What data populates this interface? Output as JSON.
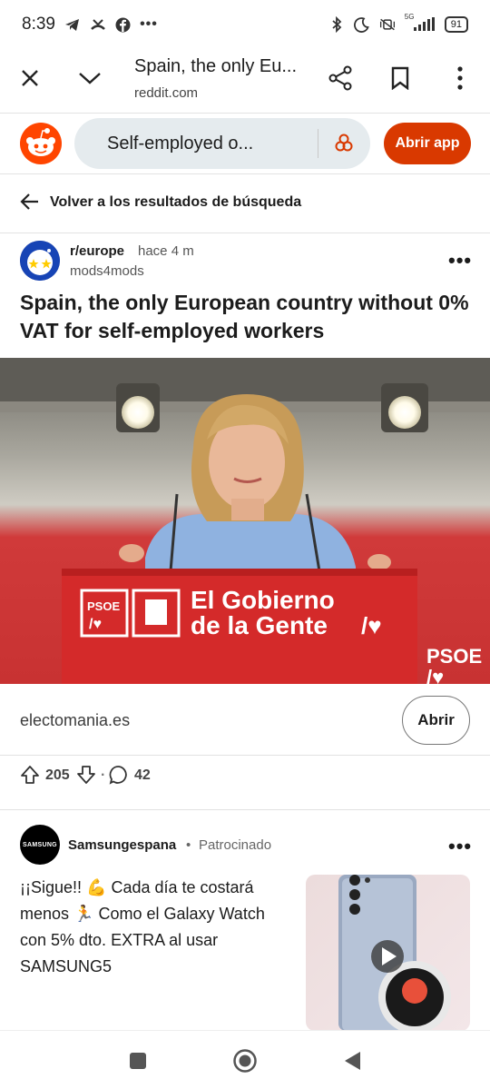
{
  "status_bar": {
    "time": "8:39",
    "network": "5G",
    "battery": "91"
  },
  "browser_tab": {
    "title": "Spain, the only Eu...",
    "url": "reddit.com"
  },
  "reddit_bar": {
    "search_text": "Self-employed o...",
    "open_app_label": "Abrir app"
  },
  "back": {
    "label": "Volver a los resultados de búsqueda"
  },
  "post": {
    "subreddit": "r/europe",
    "time": "hace 4 m",
    "author": "mods4mods",
    "title": "Spain, the only European country without 0% VAT for self-employed workers",
    "image_banner_line1": "El Gobierno",
    "image_banner_line2": "de la Gente",
    "image_logo": "PSOE",
    "link_domain": "electomania.es",
    "link_button": "Abrir",
    "upvotes": "205",
    "comments": "42"
  },
  "ad": {
    "avatar_text": "SAMSUNG",
    "advertiser": "Samsungespana",
    "separator": "•",
    "sponsored_label": "Patrocinado",
    "body": "¡¡Sigue!! 💪 Cada día te costará menos 🏃 Como el Galaxy Watch con 5% dto. EXTRA al usar SAMSUNG5"
  },
  "colors": {
    "accent": "#d93900",
    "reddit_orange": "#ff4500",
    "search_bg": "#e5ebee"
  }
}
